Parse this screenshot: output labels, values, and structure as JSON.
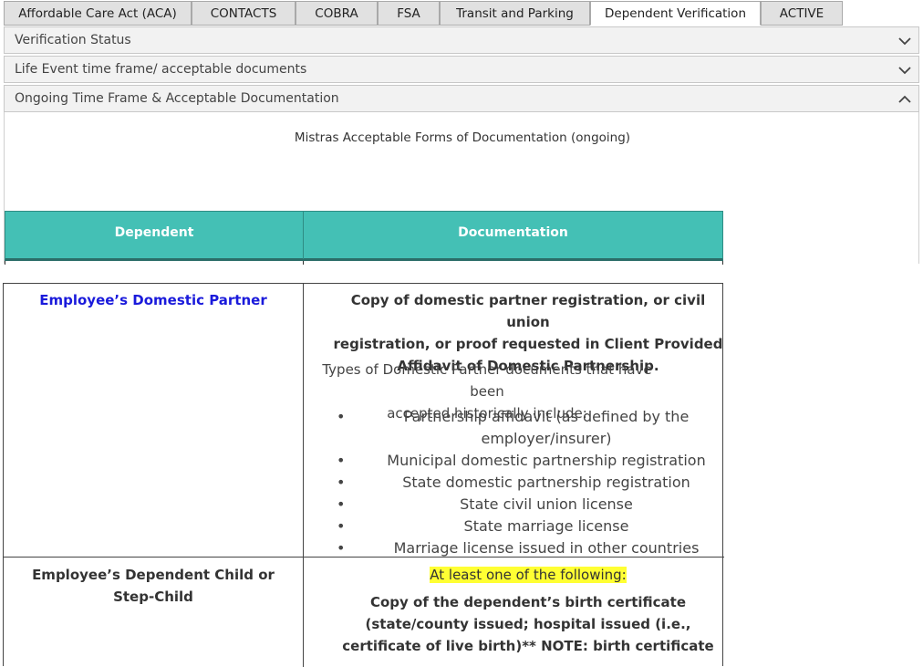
{
  "tabs": [
    {
      "label": "Affordable Care Act (ACA)",
      "active": false
    },
    {
      "label": "CONTACTS",
      "active": false
    },
    {
      "label": "COBRA",
      "active": false
    },
    {
      "label": "FSA",
      "active": false
    },
    {
      "label": "Transit and Parking",
      "active": false
    },
    {
      "label": "Dependent Verification",
      "active": true
    },
    {
      "label": "ACTIVE",
      "active": false
    }
  ],
  "accordion": [
    {
      "title": "Verification Status",
      "expanded": false
    },
    {
      "title": "Life Event time frame/ acceptable documents",
      "expanded": false
    },
    {
      "title": "Ongoing Time Frame & Acceptable Documentation",
      "expanded": true
    }
  ],
  "panel": {
    "subtitle": "Mistras Acceptable Forms of Documentation (ongoing)",
    "header": {
      "col1": "Dependent",
      "col2": "Documentation"
    }
  },
  "doc": {
    "row1": {
      "dependent": "Employee’s Domestic Partner",
      "bold_lines": [
        "Copy of domestic partner registration, or civil union",
        "registration, or proof requested in Client Provided",
        "Affidavit of Domestic Partnership."
      ],
      "intro_lines": [
        "Types of Domestic Partner documents that have been",
        "accepted historically include:"
      ],
      "bullets": [
        [
          "Partnership affidavit (as defined by the",
          "employer/insurer)"
        ],
        [
          "Municipal domestic partnership registration"
        ],
        [
          "State domestic partnership registration"
        ],
        [
          "State civil union license"
        ],
        [
          "State marriage license"
        ],
        [
          "Marriage license issued in other countries"
        ]
      ]
    },
    "row2": {
      "dependent_lines": [
        "Employee’s Dependent Child or",
        "Step-Child"
      ],
      "highlight": "At least one of the following:",
      "bold_lines": [
        "Copy of the dependent’s birth certificate",
        "(state/county issued; hospital issued (i.e.,",
        "certificate of live birth)** NOTE: birth certificate"
      ]
    }
  },
  "colors": {
    "header": "#44c0b5",
    "link": "#1a1adb",
    "highlight": "#ffff33"
  }
}
